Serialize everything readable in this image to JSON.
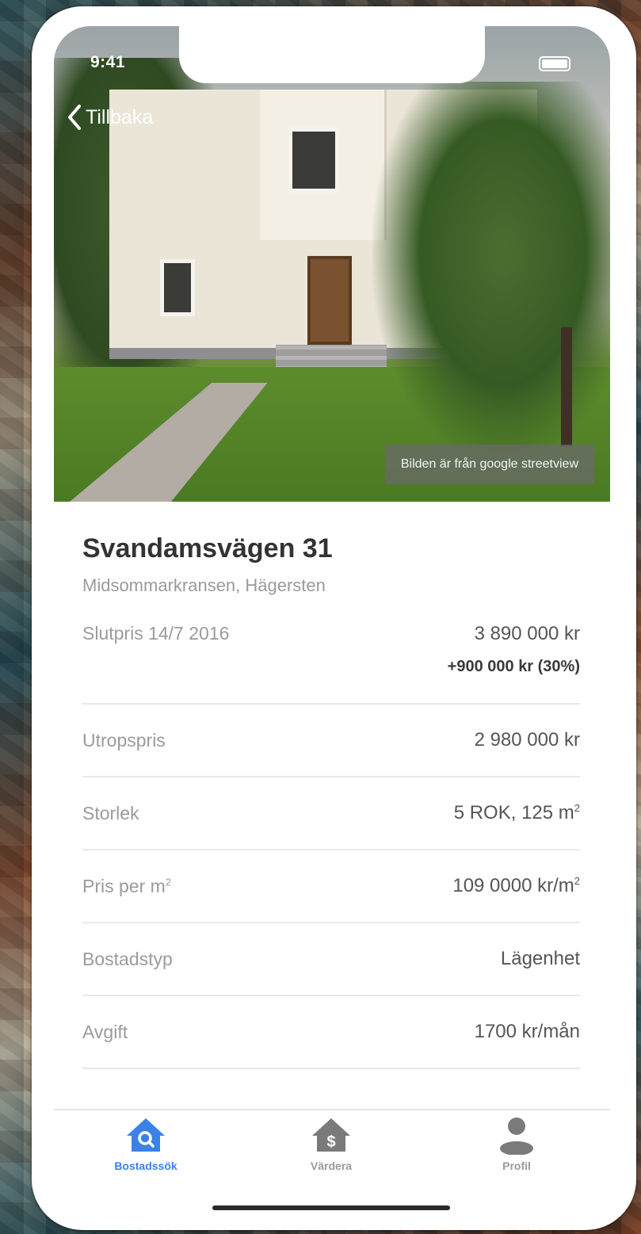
{
  "status_bar": {
    "time": "9:41"
  },
  "nav": {
    "back_label": "Tillbaka"
  },
  "hero": {
    "caption": "Bilden är från google streetview"
  },
  "listing": {
    "address": "Svandamsvägen 31",
    "area": "Midsommarkransen, Hägersten",
    "sold_label": "Slutpris 14/7 2016",
    "sold_price": "3 890 000 kr",
    "price_change": "+900 000 kr (30%)",
    "rows": [
      {
        "label": "Utropspris",
        "value": "2 980 000 kr"
      },
      {
        "label": "Storlek",
        "value": "5 ROK, 125 m",
        "value_sup": "2"
      },
      {
        "label": "Pris per m",
        "label_sup": "2",
        "value": "109 0000 kr/m",
        "value_sup": "2"
      },
      {
        "label": "Bostadstyp",
        "value": "Lägenhet"
      },
      {
        "label": "Avgift",
        "value": "1700 kr/mån"
      }
    ]
  },
  "tabbar": {
    "tabs": [
      {
        "label": "Bostadssök",
        "icon": "home-search-icon",
        "active": true
      },
      {
        "label": "Värdera",
        "icon": "home-dollar-icon",
        "active": false
      },
      {
        "label": "Profil",
        "icon": "person-icon",
        "active": false
      }
    ]
  },
  "colors": {
    "accent": "#3b82e8",
    "inactive_tab": "#7a7a7a",
    "text_primary": "#333333",
    "text_secondary": "#9b9b9b"
  }
}
